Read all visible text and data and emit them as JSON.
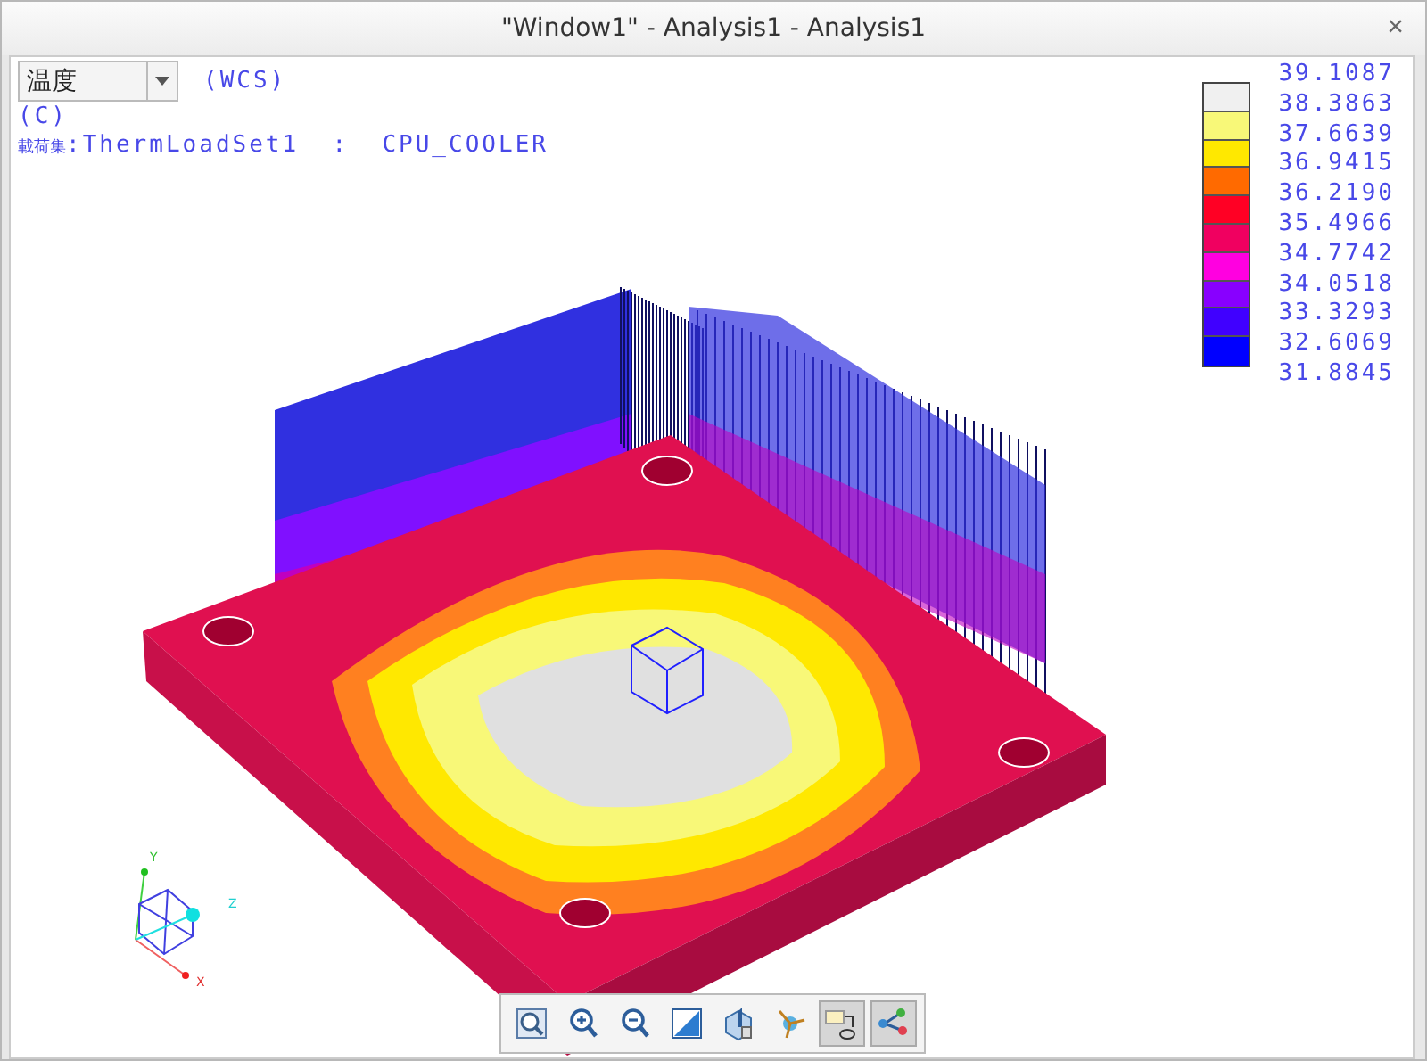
{
  "window": {
    "title": "\"Window1\" - Analysis1 - Analysis1",
    "close": "×"
  },
  "quantity_select": {
    "value": "温度"
  },
  "coord_system": "(WCS)",
  "unit": "(C)",
  "load_set": {
    "label": "載荷集",
    "value": ":ThermLoadSet1  :  CPU_COOLER"
  },
  "legend": {
    "bands": [
      {
        "color": "#f0f0f0"
      },
      {
        "color": "#f8f878"
      },
      {
        "color": "#ffe800"
      },
      {
        "color": "#ff6a00"
      },
      {
        "color": "#ff0024"
      },
      {
        "color": "#f00060"
      },
      {
        "color": "#ff00e0"
      },
      {
        "color": "#8800ff"
      },
      {
        "color": "#4000ff"
      },
      {
        "color": "#0000ff"
      }
    ],
    "labels": [
      "39.1087",
      "38.3863",
      "37.6639",
      "36.9415",
      "36.2190",
      "35.4966",
      "34.7742",
      "34.0518",
      "33.3293",
      "32.6069",
      "31.8845"
    ]
  },
  "triad": {
    "x": "X",
    "y": "Y",
    "z": "Z"
  },
  "toolbar": [
    {
      "kind": "fit",
      "selected": false
    },
    {
      "kind": "zoomin",
      "selected": false
    },
    {
      "kind": "zoomout",
      "selected": false
    },
    {
      "kind": "shade",
      "selected": false
    },
    {
      "kind": "cube",
      "selected": false
    },
    {
      "kind": "spin",
      "selected": false
    },
    {
      "kind": "display",
      "selected": true
    },
    {
      "kind": "network",
      "selected": true
    }
  ]
}
